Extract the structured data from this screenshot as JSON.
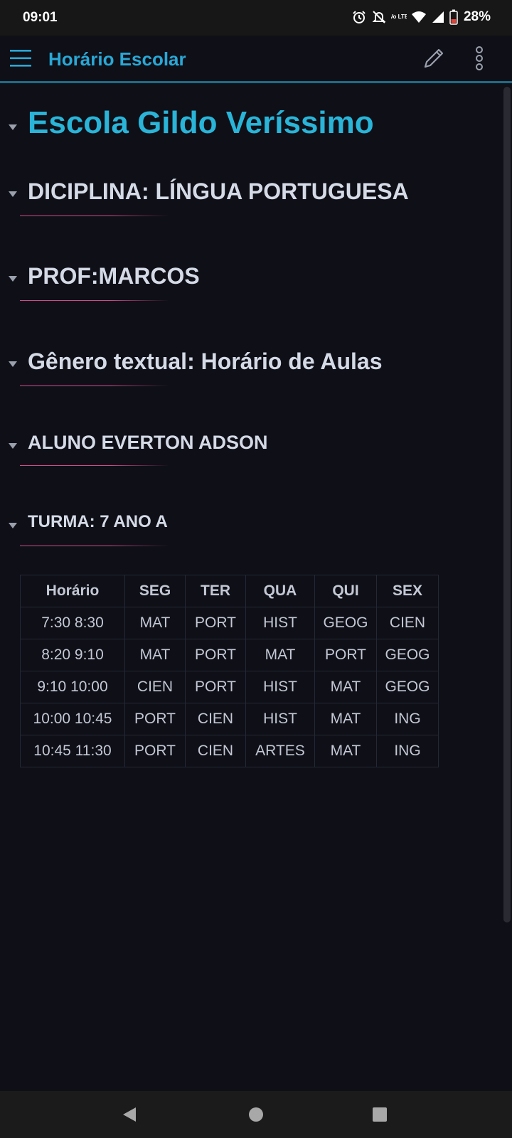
{
  "status_bar": {
    "time": "09:01",
    "volte_label": "Vo LTE",
    "battery_percent": "28%",
    "icons": [
      "alarm-icon",
      "notifications-off-icon",
      "volte-icon",
      "wifi-icon",
      "signal-icon",
      "battery-low-icon"
    ]
  },
  "app_bar": {
    "title": "Horário Escolar",
    "accent_color": "#29a8d6",
    "icons": [
      "menu-icon",
      "edit-pencil-icon",
      "more-vertical-icon"
    ]
  },
  "document": {
    "sections": [
      {
        "text": "Escola Gildo Veríssimo",
        "level": 1
      },
      {
        "text": "DICIPLINA: LÍNGUA PORTUGUESA",
        "level": 2
      },
      {
        "text": "PROF:MARCOS",
        "level": 2
      },
      {
        "text": "Gênero textual: Horário de Aulas",
        "level": 2
      },
      {
        "text": "ALUNO EVERTON ADSON",
        "level": 3
      },
      {
        "text": "TURMA: 7 ANO A",
        "level": 4
      }
    ],
    "underline_color": "#d14a87"
  },
  "schedule_table": {
    "headers": [
      "Horário",
      "SEG",
      "TER",
      "QUA",
      "QUI",
      "SEX"
    ],
    "rows": [
      [
        "7:30 8:30",
        "MAT",
        "PORT",
        "HIST",
        "GEOG",
        "CIEN"
      ],
      [
        "8:20 9:10",
        "MAT",
        "PORT",
        "MAT",
        "PORT",
        "GEOG"
      ],
      [
        "9:10 10:00",
        "CIEN",
        "PORT",
        "HIST",
        "MAT",
        "GEOG"
      ],
      [
        "10:00 10:45",
        "PORT",
        "CIEN",
        "HIST",
        "MAT",
        "ING"
      ],
      [
        "10:45 11:30",
        "PORT",
        "CIEN",
        "ARTES",
        "MAT",
        "ING"
      ]
    ]
  },
  "nav_bar": {
    "icons": [
      "back-triangle-icon",
      "home-circle-icon",
      "recents-square-icon"
    ]
  }
}
